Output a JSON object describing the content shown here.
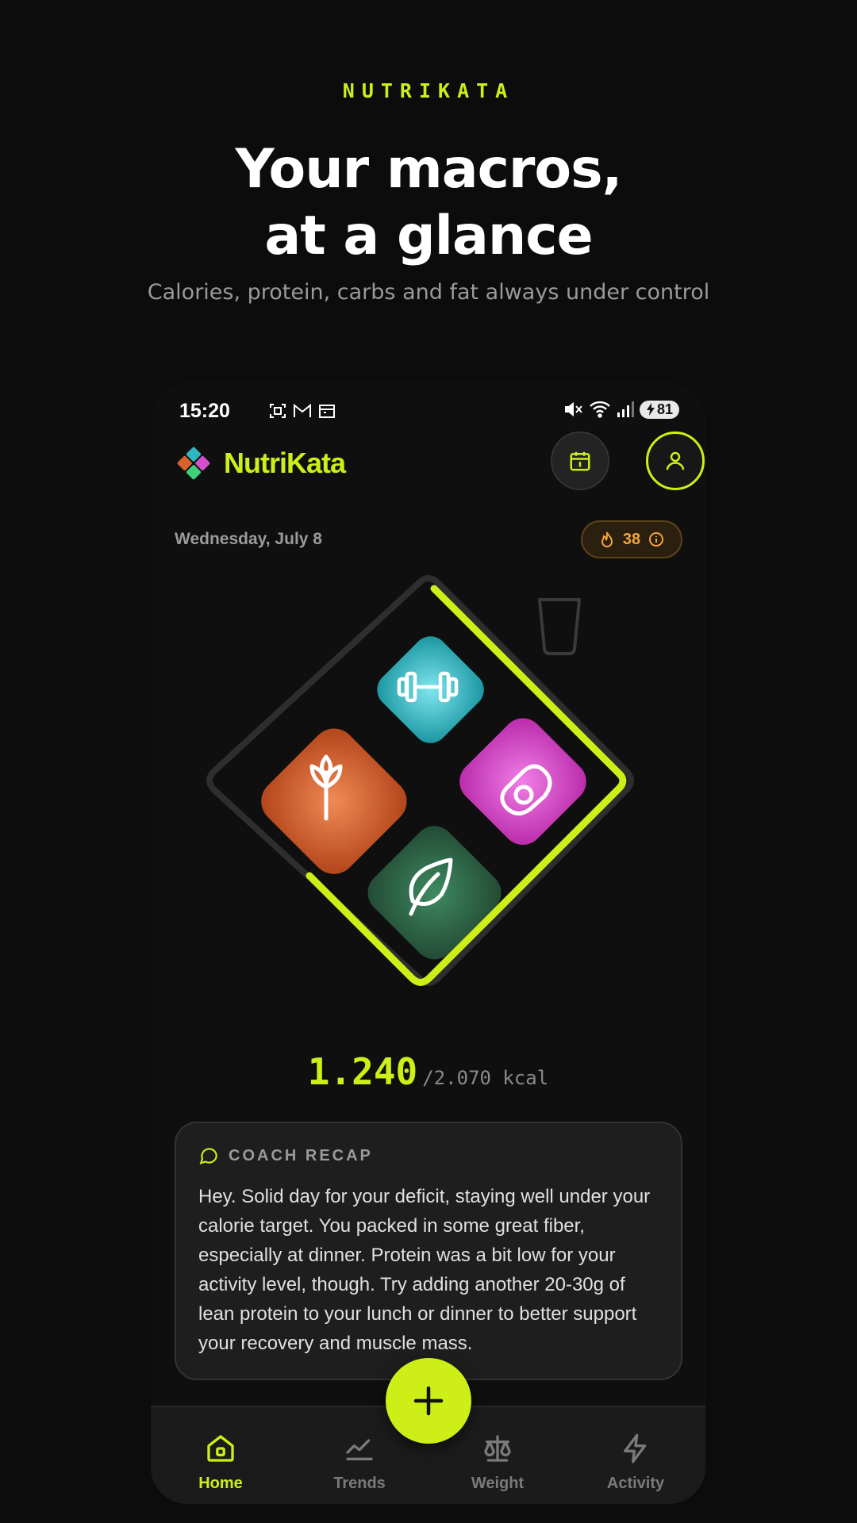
{
  "promo": {
    "brand": "NUTRIKATA",
    "title_line1": "Your macros,",
    "title_line2": "at a glance",
    "subtitle": "Calories, protein, carbs and fat always under control"
  },
  "status": {
    "time": "15:20",
    "battery": "81"
  },
  "header": {
    "app_name": "NutriKata"
  },
  "date": "Wednesday, July 8",
  "streak": {
    "count": "38"
  },
  "calories": {
    "consumed": "1.240",
    "goal": "/2.070 kcal",
    "progress": 0.6
  },
  "recap": {
    "title": "COACH RECAP",
    "body": "Hey. Solid day for your deficit, staying well under your calorie target. You packed in some great fiber, especially at dinner. Protein was a bit low for your activity level, though. Try adding another 20-30g of lean protein to your lunch or dinner to better support your recovery and muscle mass."
  },
  "nav": {
    "items": [
      {
        "label": "Home",
        "icon": "home-icon",
        "active": true
      },
      {
        "label": "Trends",
        "icon": "trends-icon",
        "active": false
      },
      {
        "label": "Weight",
        "icon": "scale-icon",
        "active": false
      },
      {
        "label": "Activity",
        "icon": "lightning-icon",
        "active": false
      }
    ]
  },
  "colors": {
    "accent": "#cdef17",
    "protein": "#2fb6c0",
    "carbs": "#d8622c",
    "fat": "#d43fc4",
    "fiber": "#2d6a4a",
    "streak": "#f3a43a"
  }
}
